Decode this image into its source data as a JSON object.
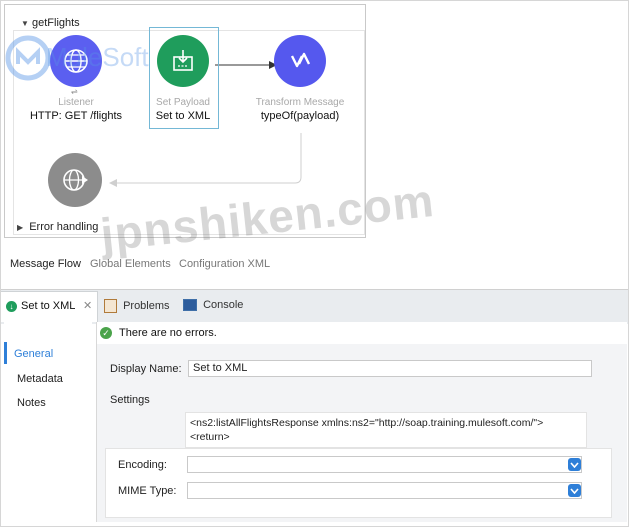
{
  "flow": {
    "name": "getFlights",
    "listener": {
      "label": "Listener",
      "sub": "HTTP: GET /flights"
    },
    "set_payload": {
      "label": "Set Payload",
      "sub": "Set to XML"
    },
    "transform": {
      "label": "Transform Message",
      "sub": "typeOf(payload)"
    },
    "error_handling": "Error handling"
  },
  "editor_tabs": [
    "Message Flow",
    "Global Elements",
    "Configuration XML"
  ],
  "watermark": {
    "brand": "MuleSoft",
    "site": "jpnshiken.com"
  },
  "panel_tabs": {
    "active": "Set to XML",
    "problems": "Problems",
    "console": "Console"
  },
  "status": "There are no errors.",
  "sidebar": {
    "items": [
      "General",
      "Metadata",
      "Notes"
    ]
  },
  "form": {
    "display_name_label": "Display Name:",
    "display_name_value": "Set to XML",
    "settings_label": "Settings",
    "value_line1": "<ns2:listAllFlightsResponse xmlns:ns2=\"http://soap.training.mulesoft.com/\">",
    "value_line2": "<return>",
    "encoding_label": "Encoding:",
    "encoding_value": "",
    "mime_label": "MIME Type:",
    "mime_value": ""
  },
  "colors": {
    "listener": "#5b5ff0",
    "set_payload": "#1f9d5c",
    "transform": "#5558ee",
    "error_node": "#8c8c8c",
    "selection": "#74b8d6",
    "accent": "#2e7fd8"
  }
}
